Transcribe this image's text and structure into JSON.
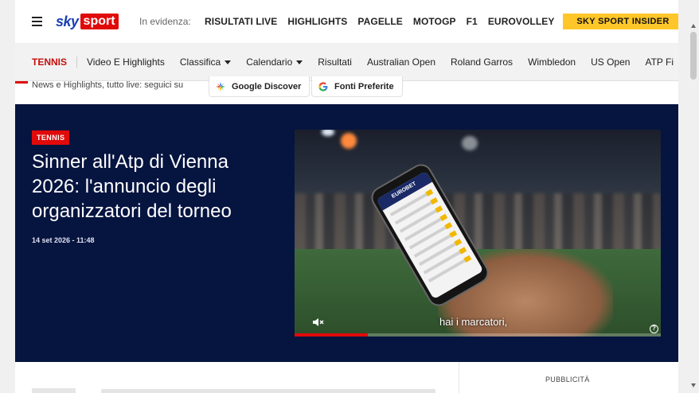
{
  "header": {
    "logo_sky": "sky",
    "logo_sport": "sport",
    "evidenza_label": "In evidenza:",
    "links": [
      "RISULTATI LIVE",
      "HIGHLIGHTS",
      "PAGELLE",
      "MOTOGP",
      "F1",
      "EUROVOLLEY"
    ],
    "insider_label": "SKY SPORT INSIDER",
    "colors": {
      "brand_blue": "#1b3fb4",
      "brand_red": "#e10a0a",
      "insider_yellow": "#ffc629"
    }
  },
  "subnav": {
    "section": "TENNIS",
    "items": [
      {
        "label": "Video E Highlights",
        "dropdown": false
      },
      {
        "label": "Classifica",
        "dropdown": true
      },
      {
        "label": "Calendario",
        "dropdown": true
      },
      {
        "label": "Risultati",
        "dropdown": false
      },
      {
        "label": "Australian Open",
        "dropdown": false
      },
      {
        "label": "Roland Garros",
        "dropdown": false
      },
      {
        "label": "Wimbledon",
        "dropdown": false
      },
      {
        "label": "US Open",
        "dropdown": false
      },
      {
        "label": "ATP Fi",
        "dropdown": false
      }
    ]
  },
  "discover": {
    "text": "News e Highlights, tutto live: seguici su",
    "google_discover": "Google Discover",
    "fonti_preferite": "Fonti Preferite"
  },
  "hero": {
    "tag": "TENNIS",
    "headline": "Sinner all'Atp di Vienna 2026: l'annuncio degli organizzatori del torneo",
    "date": "14 set 2026 - 11:48",
    "video": {
      "caption": "hai i marcatori,",
      "phone_brand": "EUROBET",
      "progress": 0.2
    }
  },
  "sidebar": {
    "advertising_label": "PUBBLICITÀ"
  }
}
